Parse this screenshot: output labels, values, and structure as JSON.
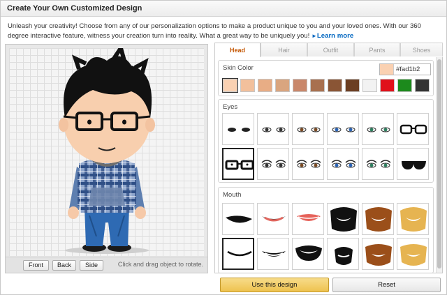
{
  "dialog": {
    "title": "Create Your Own Customized Design",
    "intro": "Unleash your creativity! Choose from any of our personalization options to make a product unique to you and your loved ones. With our 360 degree interactive feature, witness your creation turn into reality. What a great way to be uniquely you!",
    "learn_more": "Learn more"
  },
  "preview": {
    "views": [
      "Front",
      "Back",
      "Side"
    ],
    "hint": "Click and drag object to rotate."
  },
  "tabs": [
    "Head",
    "Hair",
    "Outfit",
    "Pants",
    "Shoes"
  ],
  "active_tab": "Head",
  "skin": {
    "label": "Skin Color",
    "hex": "#fad1b2",
    "swatches": [
      "#fad1b2",
      "#f2c09c",
      "#e8ad85",
      "#d9a57f",
      "#c9876a",
      "#a8704f",
      "#8a5535",
      "#6b3e22",
      "#f2f2f2",
      "#e0101a",
      "#1c8a1c",
      "#333333"
    ],
    "selected_index": 0
  },
  "eyes": {
    "label": "Eyes",
    "selected_index": 6
  },
  "mouth": {
    "label": "Mouth",
    "selected_index": 6
  },
  "buttons": {
    "use": "Use this design",
    "reset": "Reset"
  }
}
